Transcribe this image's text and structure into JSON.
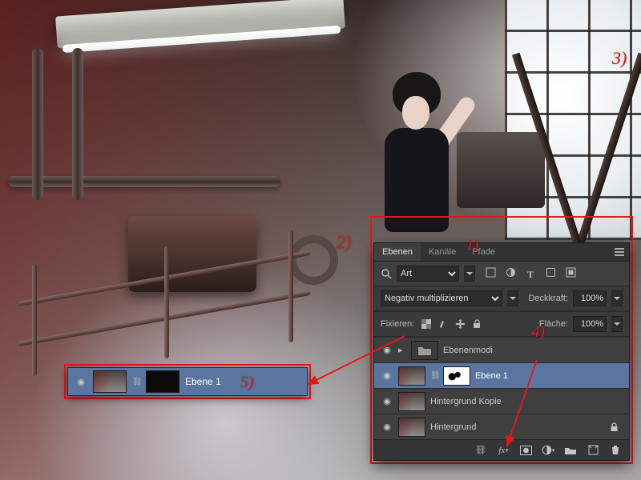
{
  "annotations": {
    "n1": "1)",
    "n2": "2)",
    "n3": "3)",
    "n4": "4)",
    "n5": "5)"
  },
  "panel": {
    "tabs": {
      "layers": "Ebenen",
      "channels": "Kanäle",
      "paths": "Pfade"
    },
    "filter_kind": "Art",
    "filter_search_icon": "search-icon",
    "blend_mode": "Negativ multiplizieren",
    "opacity_label": "Deckkraft:",
    "opacity_value": "100%",
    "lock_label": "Fixieren:",
    "fill_label": "Fläche:",
    "fill_value": "100%",
    "layers": [
      {
        "name": "Ebenenmodi",
        "type": "group"
      },
      {
        "name": "Ebene 1",
        "type": "masked",
        "selected": true
      },
      {
        "name": "Hintergrund Kopie",
        "type": "image"
      },
      {
        "name": "Hintergrund",
        "type": "image",
        "locked": true
      }
    ]
  },
  "zoom_row": {
    "name": "Ebene 1"
  }
}
